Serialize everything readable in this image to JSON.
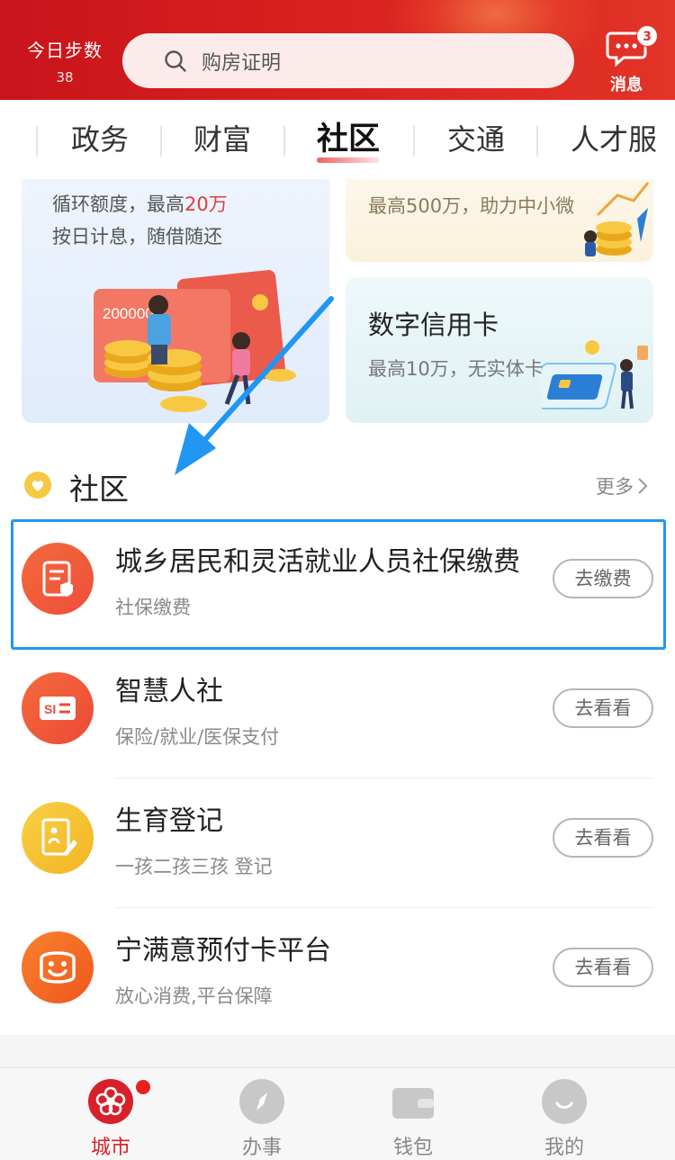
{
  "header": {
    "steps_label": "今日步数",
    "steps_count": "38",
    "search_placeholder": "购房证明",
    "message_label": "消息",
    "message_badge": "3"
  },
  "tabs": [
    {
      "label": "政务"
    },
    {
      "label": "财富"
    },
    {
      "label": "社区",
      "active": true
    },
    {
      "label": "交通"
    },
    {
      "label": "人才服"
    }
  ],
  "banners": {
    "left": {
      "line1_prefix": "循环额度，最高",
      "line1_highlight": "20万",
      "line2": "按日计息，随借随还",
      "card_text": "200000"
    },
    "right_top": {
      "line1": "最高500万，助力中小微"
    },
    "right_bottom": {
      "title": "数字信用卡",
      "subtitle": "最高10万，无实体卡"
    }
  },
  "section": {
    "title": "社区",
    "more": "更多"
  },
  "items": [
    {
      "title": "城乡居民和灵活就业人员社保缴费",
      "subtitle": "社保缴费",
      "button": "去缴费",
      "icon": "document-shield-icon",
      "color": "#f25a3a"
    },
    {
      "title": "智慧人社",
      "subtitle": "保险/就业/医保支付",
      "button": "去看看",
      "icon": "si-card-icon",
      "color": "#f0553a"
    },
    {
      "title": "生育登记",
      "subtitle": "一孩二孩三孩 登记",
      "button": "去看看",
      "icon": "registration-form-icon",
      "color": "#f5c030"
    },
    {
      "title": "宁满意预付卡平台",
      "subtitle": "放心消费,平台保障",
      "button": "去看看",
      "icon": "smiley-card-icon",
      "color": "#f36c24"
    }
  ],
  "nav": [
    {
      "label": "城市",
      "icon": "city-flower-icon",
      "active": true
    },
    {
      "label": "办事",
      "icon": "compass-icon"
    },
    {
      "label": "钱包",
      "icon": "wallet-icon"
    },
    {
      "label": "我的",
      "icon": "profile-icon"
    }
  ],
  "colors": {
    "brand_red": "#d9202a",
    "highlight_blue": "#2196f3"
  }
}
